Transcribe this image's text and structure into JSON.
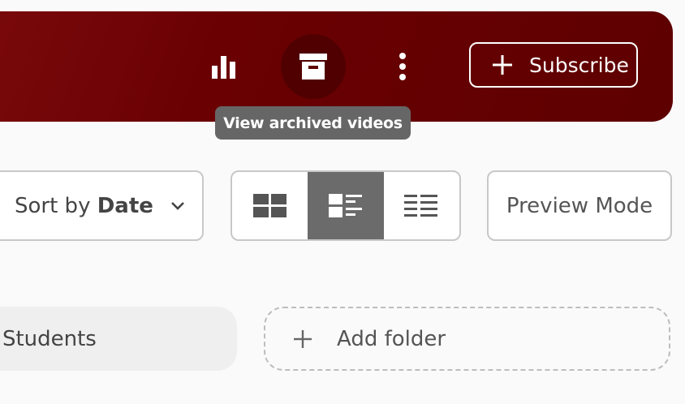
{
  "header": {
    "subscribe_label": "Subscribe",
    "tooltip": "View archived videos",
    "icons": [
      "bar-chart-icon",
      "archive-icon",
      "more-vertical-icon",
      "plus-icon"
    ]
  },
  "toolbar": {
    "sort_prefix": "Sort by",
    "sort_value": "Date",
    "view_modes": [
      "grid",
      "list-with-thumbnails",
      "compact-list"
    ],
    "selected_view": "list-with-thumbnails",
    "preview_label": "Preview Mode"
  },
  "folders": {
    "items": [
      {
        "label": "r Students"
      }
    ],
    "add_label": "Add folder"
  },
  "colors": {
    "header_bg": "#660000",
    "selected_view_bg": "#6b6b6b",
    "tooltip_bg": "#666666"
  }
}
